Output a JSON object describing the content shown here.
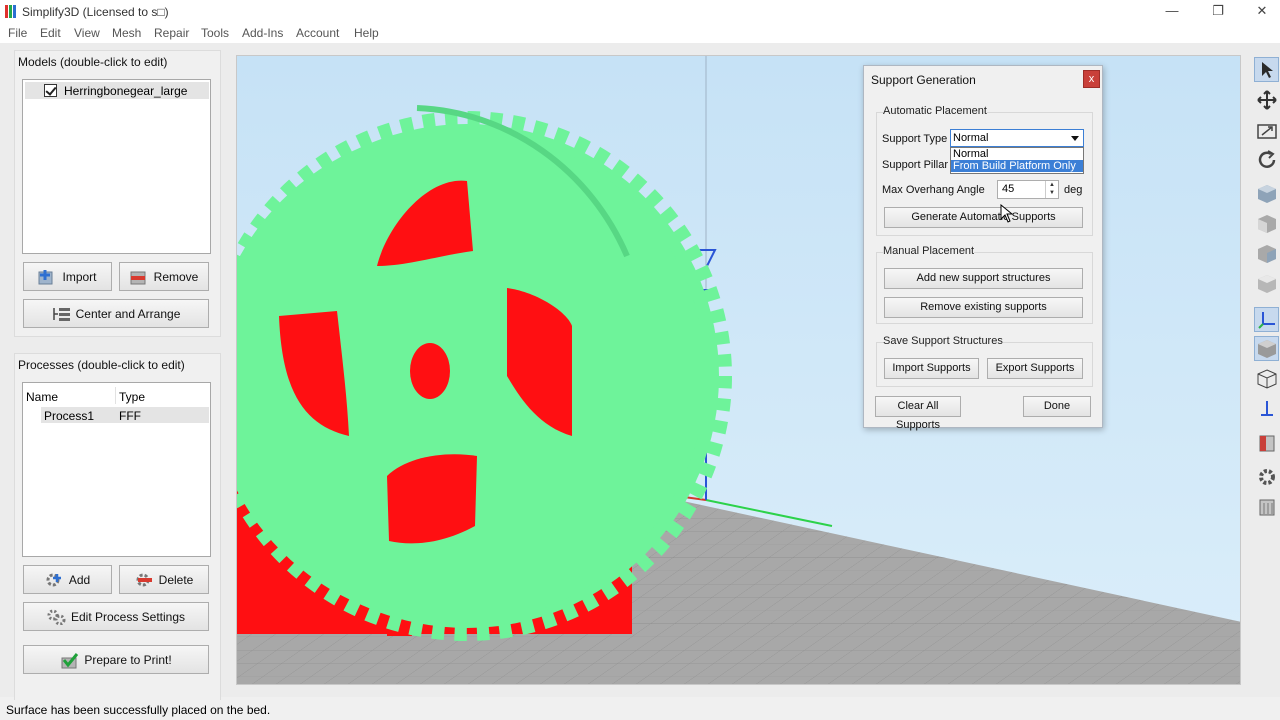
{
  "window": {
    "title": "Simplify3D (Licensed to s□)",
    "minimize": "—",
    "restore": "❐",
    "close": "✕"
  },
  "menu": [
    "File",
    "Edit",
    "View",
    "Mesh",
    "Repair",
    "Tools",
    "Add-Ins",
    "Account",
    "Help"
  ],
  "models_panel": {
    "title": "Models (double-click to edit)",
    "items": [
      {
        "name": "Herringbonegear_large",
        "checked": true
      }
    ],
    "import_label": "Import",
    "remove_label": "Remove",
    "center_arrange_label": "Center and Arrange"
  },
  "processes_panel": {
    "title": "Processes (double-click to edit)",
    "columns": [
      "Name",
      "Type"
    ],
    "rows": [
      {
        "name": "Process1",
        "type": "FFF"
      }
    ],
    "add_label": "Add",
    "delete_label": "Delete",
    "edit_settings_label": "Edit Process Settings",
    "prepare_label": "Prepare to Print!"
  },
  "support_dialog": {
    "title": "Support Generation",
    "close_label": "x",
    "automatic_group": "Automatic Placement",
    "support_type_label": "Support Type",
    "support_type_value": "Normal",
    "support_type_options": [
      "Normal",
      "From Build Platform Only"
    ],
    "support_type_highlighted": "From Build Platform Only",
    "support_pillar_label": "Support Pillar R",
    "max_overhang_label": "Max Overhang Angle",
    "max_overhang_value": "45",
    "max_overhang_unit": "deg",
    "generate_label": "Generate Automatic Supports",
    "manual_group": "Manual Placement",
    "add_new_label": "Add new support structures",
    "remove_existing_label": "Remove existing supports",
    "save_group": "Save Support Structures",
    "import_supports_label": "Import Supports",
    "export_supports_label": "Export Supports",
    "clear_all_label": "Clear All Supports",
    "done_label": "Done"
  },
  "toolbar_icons": [
    "select-icon",
    "move-icon",
    "scale-icon",
    "rotate-icon",
    "view-iso-icon",
    "view-front-icon",
    "view-side-icon",
    "view-top-icon",
    "axes-icon",
    "solid-view-icon",
    "wireframe-view-icon",
    "z-axis-icon",
    "cross-section-icon",
    "settings-gear-icon",
    "print-preview-icon"
  ],
  "colors": {
    "model": "#6ef39a",
    "support": "#ff0f12",
    "bed": "#a9a9a9",
    "sky": "#cfe6f6"
  },
  "status": {
    "message": "Surface has been successfully placed on the bed."
  }
}
